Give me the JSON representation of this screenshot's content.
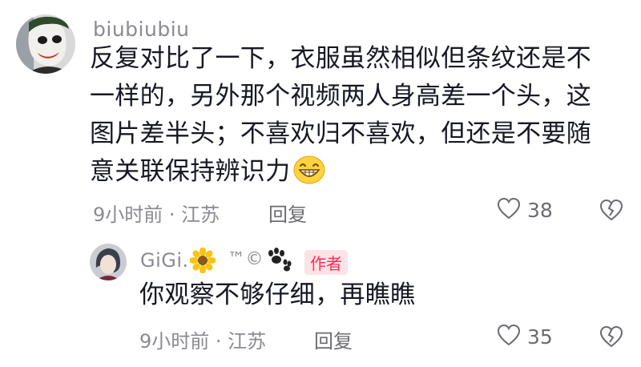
{
  "comments": [
    {
      "username": "biubiubiu",
      "text_line1": "反复对比了一下，衣服虽然相似但条纹还是不",
      "text_line2": "一样的，另外那个视频两人身高差一个头，这",
      "text_line3": "图片差半头；不喜欢归不喜欢，但还是不要随",
      "text_line4": "意关联保持辨识力",
      "emoji": "grinning-face-emoji",
      "time_location": "9小时前 · 江苏",
      "reply_label": "回复",
      "like_count": "38",
      "avatar_icon": "joker-avatar"
    }
  ],
  "reply": {
    "username": "GiGi.",
    "suffix_icons": [
      "sunflower-icon",
      "tm-copyright-icon",
      "paw-icon"
    ],
    "tm_text": "™©",
    "author_badge": "作者",
    "text": "你观察不够仔细，再瞧瞧",
    "time_location": "9小时前 · 江苏",
    "reply_label": "回复",
    "like_count": "35",
    "avatar_icon": "gigi-avatar"
  },
  "colors": {
    "primary_text": "#161823",
    "secondary_text": "#8a8b91",
    "badge_bg": "#fde3e6",
    "badge_text": "#fe2c55"
  }
}
